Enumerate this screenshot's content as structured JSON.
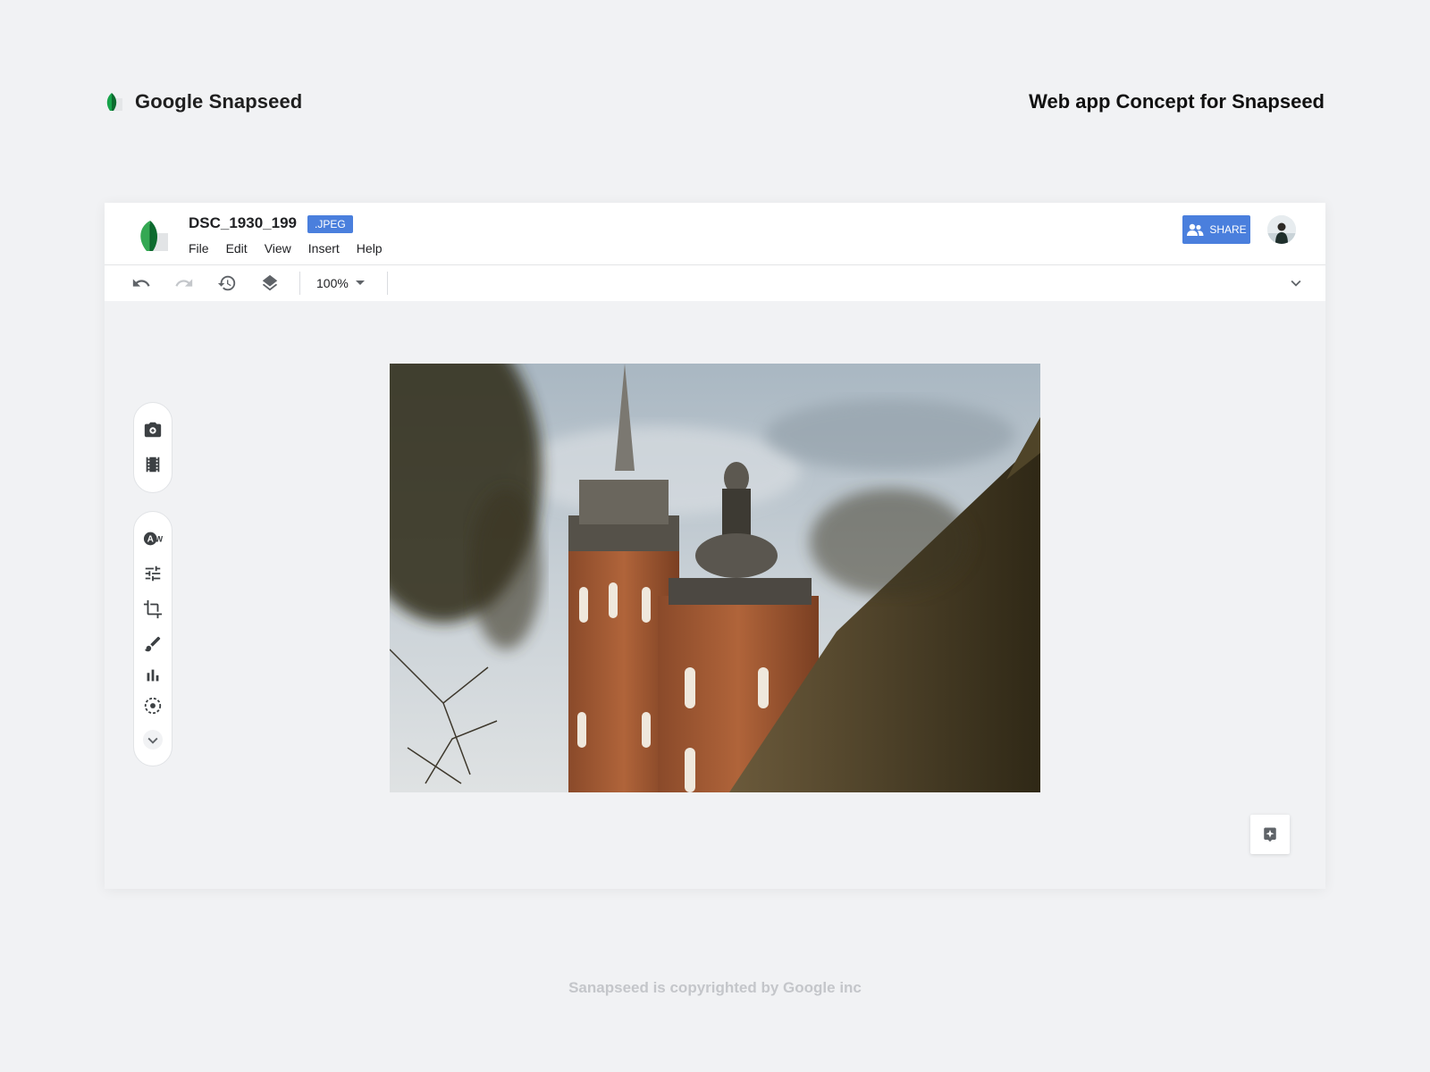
{
  "page": {
    "brand": "Google  Snapseed",
    "concept_title": "Web app Concept for Snapseed",
    "footer": "Sanapseed  is  copyrighted by Google inc"
  },
  "document": {
    "filename": "DSC_1930_199",
    "format": ".JPEG"
  },
  "menu": [
    "File",
    "Edit",
    "View",
    "Insert",
    "Help"
  ],
  "header": {
    "share_label": "SHARE"
  },
  "toolbar": {
    "zoom": "100%",
    "icons": [
      "undo-icon",
      "redo-icon",
      "history-icon",
      "layers-icon",
      "expand-icon"
    ]
  },
  "side_panel": {
    "top_icons": [
      "camera-icon",
      "film-icon"
    ],
    "tool_icons": [
      "auto-white-balance-icon",
      "tune-icon",
      "crop-icon",
      "brush-icon",
      "histogram-icon",
      "selective-icon",
      "more-icon"
    ]
  },
  "photo": {
    "subject": "church-towers-photo"
  },
  "colors": {
    "accent": "#4a7fdd",
    "background": "#f1f2f4",
    "surface": "#ffffff",
    "brand_green_dark": "#0f8a3c",
    "brand_green_light": "#7cc242"
  }
}
